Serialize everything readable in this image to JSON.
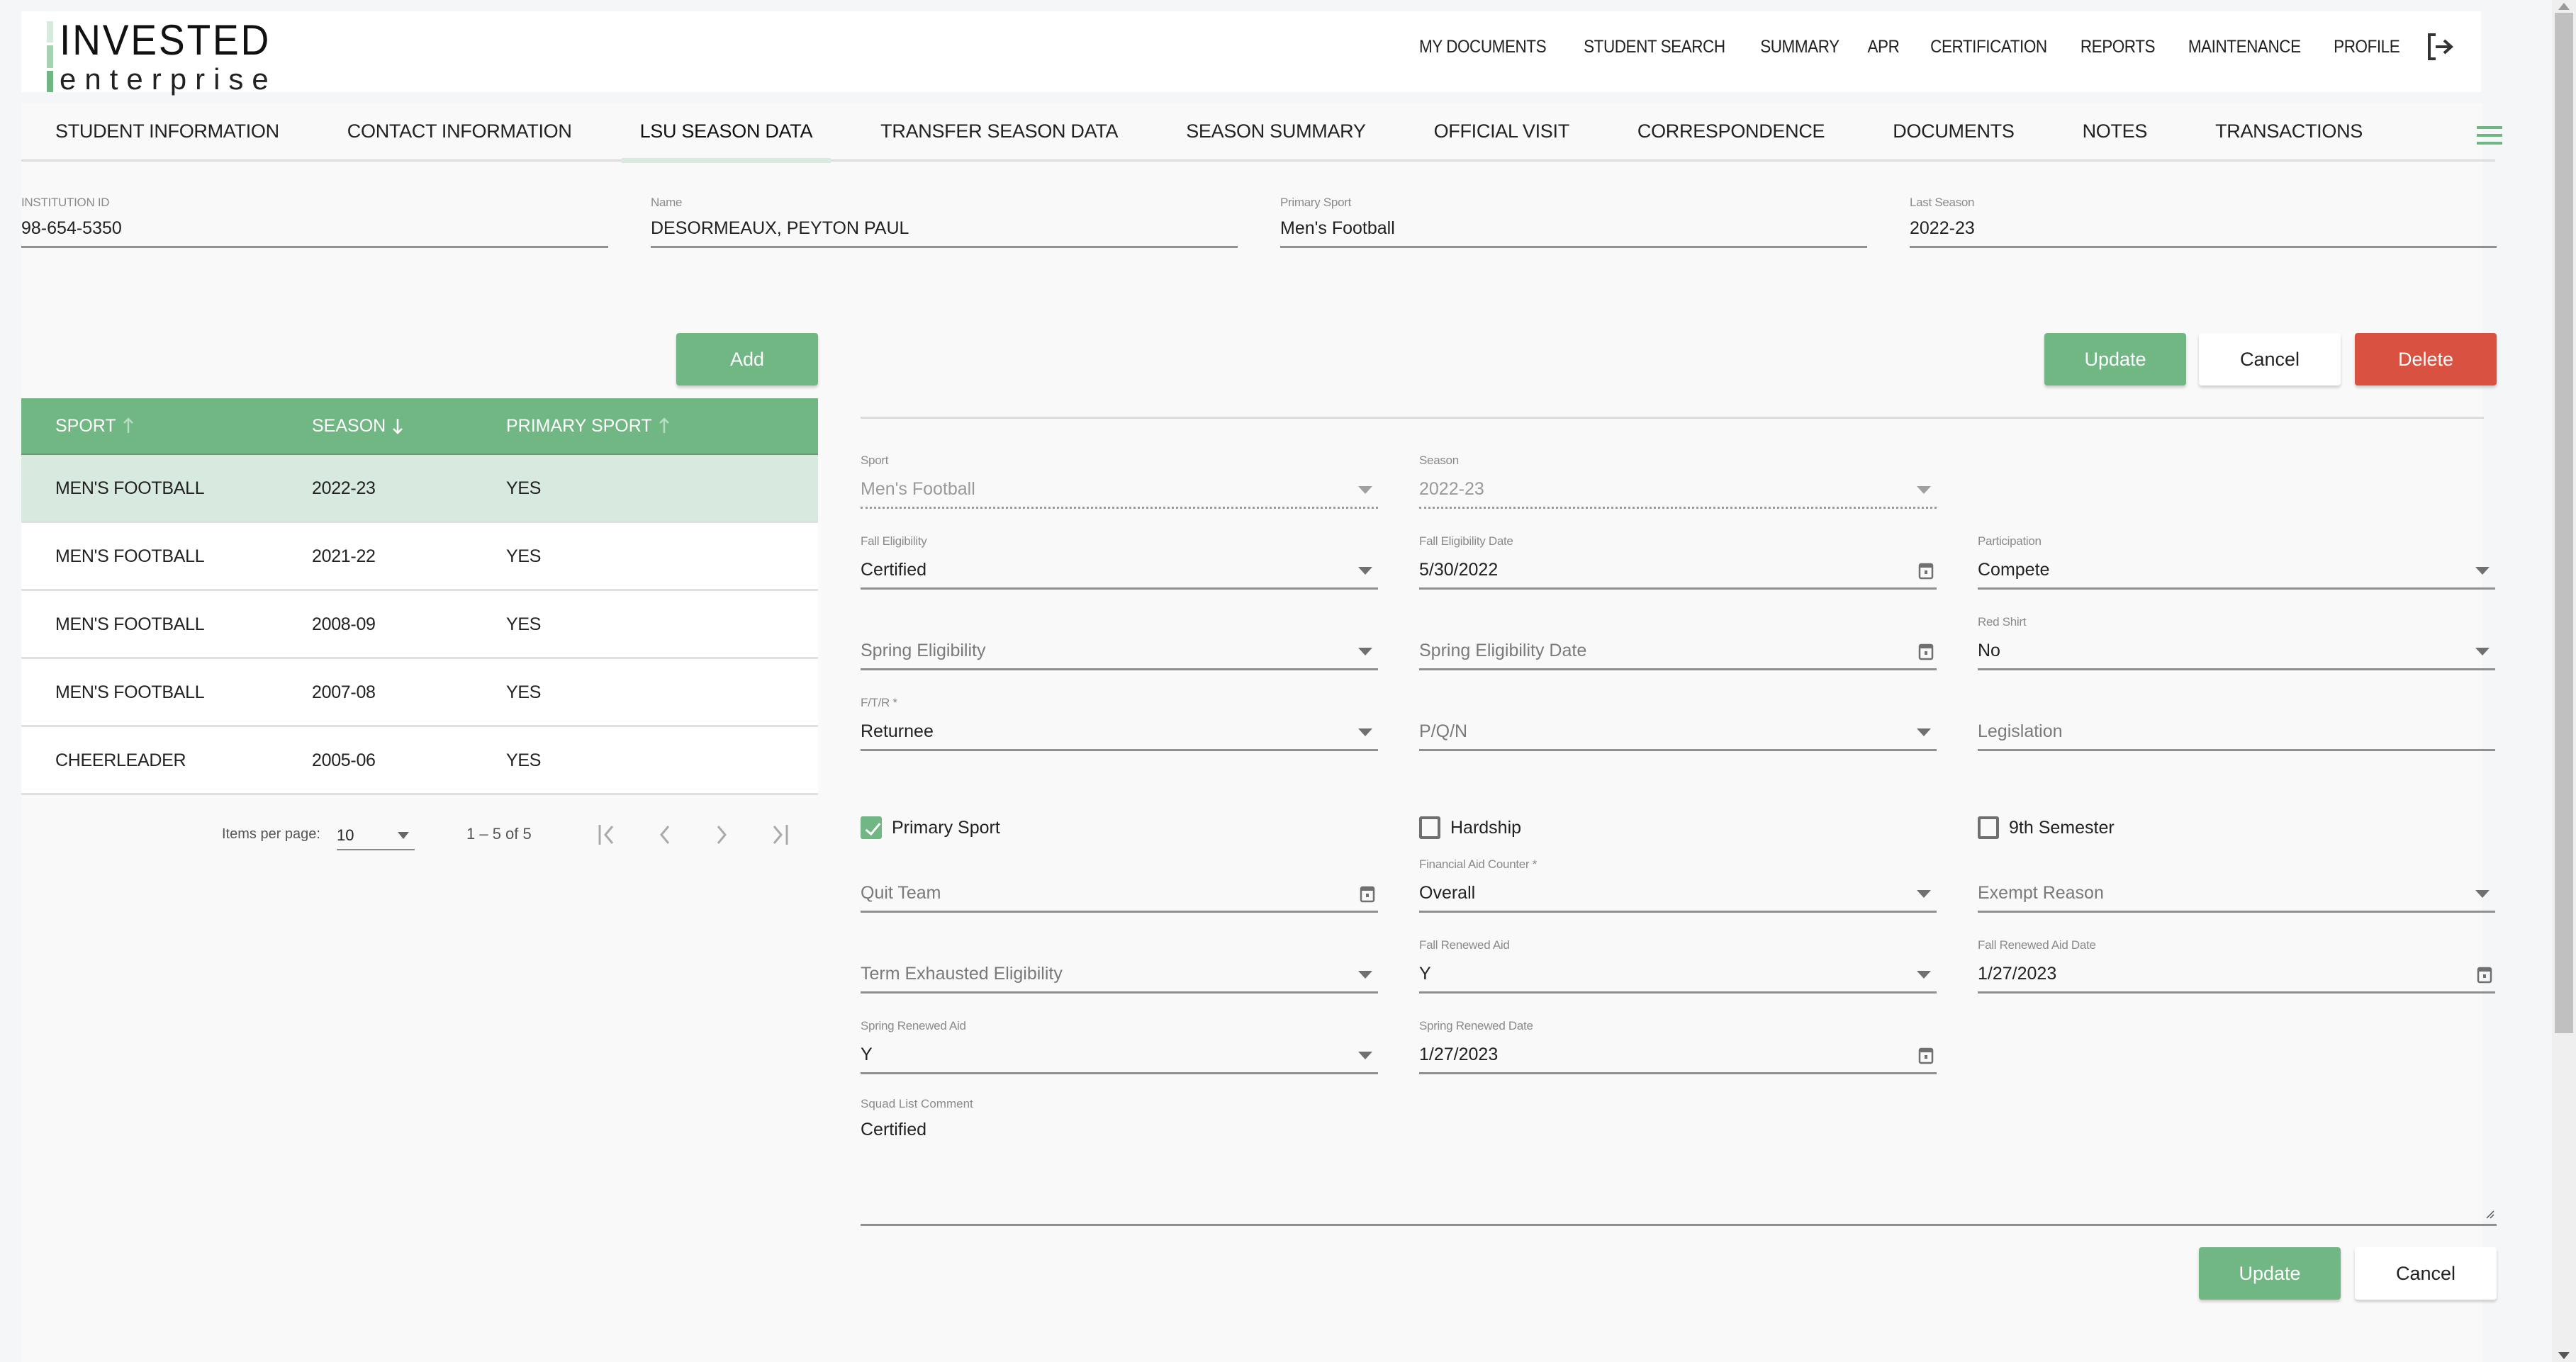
{
  "brand": {
    "line1": "INVESTED",
    "line2": "enterprise"
  },
  "topnav": {
    "items": [
      "MY DOCUMENTS",
      "STUDENT SEARCH",
      "SUMMARY",
      "APR",
      "CERTIFICATION",
      "REPORTS",
      "MAINTENANCE",
      "PROFILE"
    ],
    "logout_icon": "logout-icon"
  },
  "tabs": {
    "items": [
      "STUDENT INFORMATION",
      "CONTACT INFORMATION",
      "LSU SEASON DATA",
      "TRANSFER SEASON DATA",
      "SEASON SUMMARY",
      "OFFICIAL VISIT",
      "CORRESPONDENCE",
      "DOCUMENTS",
      "NOTES",
      "TRANSACTIONS"
    ],
    "active": "LSU SEASON DATA",
    "menu_icon": "hamburger-menu-icon"
  },
  "header_fields": {
    "institution_id": {
      "label": "INSTITUTION ID",
      "value": "98-654-5350"
    },
    "name": {
      "label": "Name",
      "value": "DESORMEAUX, PEYTON PAUL"
    },
    "primary_sport": {
      "label": "Primary Sport",
      "value": "Men's Football"
    },
    "last_season": {
      "label": "Last Season",
      "value": "2022-23"
    }
  },
  "season_table": {
    "add_label": "Add",
    "columns": [
      {
        "label": "SPORT",
        "sort": "asc"
      },
      {
        "label": "SEASON",
        "sort": "desc"
      },
      {
        "label": "PRIMARY SPORT",
        "sort": "asc"
      }
    ],
    "rows": [
      {
        "sport": "MEN'S FOOTBALL",
        "season": "2022-23",
        "primary": "YES",
        "selected": true
      },
      {
        "sport": "MEN'S FOOTBALL",
        "season": "2021-22",
        "primary": "YES"
      },
      {
        "sport": "MEN'S FOOTBALL",
        "season": "2008-09",
        "primary": "YES"
      },
      {
        "sport": "MEN'S FOOTBALL",
        "season": "2007-08",
        "primary": "YES"
      },
      {
        "sport": "CHEERLEADER",
        "season": "2005-06",
        "primary": "YES"
      }
    ],
    "paginator": {
      "items_per_page_label": "Items per page:",
      "items_per_page": "10",
      "range": "1 – 5 of 5"
    }
  },
  "form": {
    "actions_top": {
      "update": "Update",
      "cancel": "Cancel",
      "delete": "Delete"
    },
    "actions_bottom": {
      "update": "Update",
      "cancel": "Cancel"
    },
    "sport": {
      "label": "Sport",
      "value": "Men's Football"
    },
    "season": {
      "label": "Season",
      "value": "2022-23"
    },
    "fall_eligibility": {
      "label": "Fall Eligibility",
      "value": "Certified"
    },
    "fall_eligibility_date": {
      "label": "Fall Eligibility Date",
      "value": "5/30/2022"
    },
    "participation": {
      "label": "Participation",
      "value": "Compete"
    },
    "spring_eligibility": {
      "placeholder": "Spring Eligibility"
    },
    "spring_eligibility_date": {
      "placeholder": "Spring Eligibility Date"
    },
    "red_shirt": {
      "label": "Red Shirt",
      "value": "No"
    },
    "ftr": {
      "label": "F/T/R *",
      "value": "Returnee"
    },
    "pqn": {
      "placeholder": "P/Q/N"
    },
    "legislation": {
      "placeholder": "Legislation"
    },
    "primary_sport_cb": {
      "label": "Primary Sport",
      "checked": true
    },
    "hardship_cb": {
      "label": "Hardship",
      "checked": false
    },
    "ninth_semester_cb": {
      "label": "9th Semester",
      "checked": false
    },
    "quit_team": {
      "placeholder": "Quit Team"
    },
    "financial_aid_counter": {
      "label": "Financial Aid Counter *",
      "value": "Overall"
    },
    "exempt_reason": {
      "placeholder": "Exempt Reason"
    },
    "term_exhausted": {
      "placeholder": "Term Exhausted Eligibility"
    },
    "fall_renewed_aid": {
      "label": "Fall Renewed Aid",
      "value": "Y"
    },
    "fall_renewed_aid_date": {
      "label": "Fall Renewed Aid Date",
      "value": "1/27/2023"
    },
    "spring_renewed_aid": {
      "label": "Spring Renewed Aid",
      "value": "Y"
    },
    "spring_renewed_date": {
      "label": "Spring Renewed Date",
      "value": "1/27/2023"
    },
    "squad_list_comment": {
      "label": "Squad List Comment",
      "value": "Certified"
    }
  },
  "colors": {
    "accent": "#70b784",
    "danger": "#d95140",
    "selected_row": "#d8eae0",
    "tab_indicator": "#d8ebdf"
  }
}
